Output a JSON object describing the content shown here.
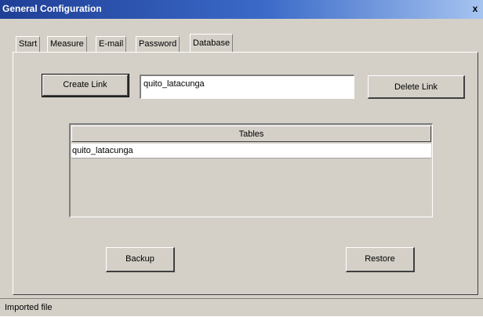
{
  "window": {
    "title": "General Configuration",
    "close_label": "x"
  },
  "tabs": [
    {
      "label": "Start"
    },
    {
      "label": "Measure"
    },
    {
      "label": "E-mail"
    },
    {
      "label": "Password"
    },
    {
      "label": "Database",
      "active": true
    }
  ],
  "link": {
    "create_label": "Create Link",
    "name_value": "quito_latacunga",
    "delete_label": "Delete Link"
  },
  "tables": {
    "header": "Tables",
    "rows": [
      "quito_latacunga"
    ]
  },
  "actions": {
    "backup_label": "Backup",
    "restore_label": "Restore"
  },
  "status": {
    "text": "Imported file"
  },
  "colors": {
    "titlebar_start": "#1f3f97",
    "titlebar_end": "#a6c4f0",
    "window_bg": "#d4d0c8"
  }
}
